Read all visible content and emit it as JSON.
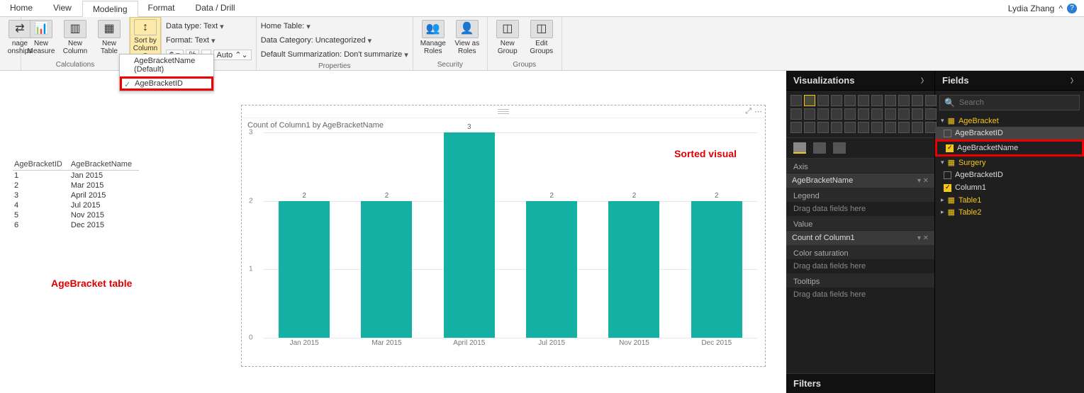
{
  "user": "Lydia Zhang",
  "tabs": [
    "Home",
    "View",
    "Modeling",
    "Format",
    "Data / Drill"
  ],
  "active_tab": "Modeling",
  "ribbon": {
    "relationships_group": "onships",
    "calculations_group": "Calculations",
    "new_measure": "New Measure",
    "new_column": "New Column",
    "new_table": "New Table",
    "sort_by": "Sort by Column",
    "data_type": "Data type: Text",
    "format": "Format: Text",
    "auto": "Auto",
    "properties_group": "Properties",
    "home_table": "Home Table:",
    "data_category": "Data Category: Uncategorized",
    "default_summ": "Default Summarization: Don't summarize",
    "security_group": "Security",
    "manage_roles": "Manage Roles",
    "view_as_roles": "View as Roles",
    "groups_group": "Groups",
    "new_group": "New Group",
    "edit_groups": "Edit Groups",
    "manage_rel": "nage onships"
  },
  "sort_dropdown": {
    "default": "AgeBracketName (Default)",
    "selected": "AgeBracketID"
  },
  "canvas_table": {
    "headers": [
      "AgeBracketID",
      "AgeBracketName"
    ],
    "rows": [
      [
        "1",
        "Jan 2015"
      ],
      [
        "2",
        "Mar 2015"
      ],
      [
        "3",
        "April 2015"
      ],
      [
        "4",
        "Jul 2015"
      ],
      [
        "5",
        "Nov 2015"
      ],
      [
        "6",
        "Dec 2015"
      ]
    ],
    "label": "AgeBracket table"
  },
  "chart_data": {
    "type": "bar",
    "title": "Count of Column1 by AgeBracketName",
    "categories": [
      "Jan 2015",
      "Mar 2015",
      "April 2015",
      "Jul 2015",
      "Nov 2015",
      "Dec 2015"
    ],
    "values": [
      2,
      2,
      3,
      2,
      2,
      2
    ],
    "ylim": [
      0,
      3
    ],
    "yticks": [
      0,
      1,
      2,
      3
    ],
    "annotation": "Sorted visual"
  },
  "viz_panel": {
    "title": "Visualizations",
    "axis_label": "Axis",
    "axis_value": "AgeBracketName",
    "legend_label": "Legend",
    "legend_placeholder": "Drag data fields here",
    "value_label": "Value",
    "value_value": "Count of Column1",
    "colorsat_label": "Color saturation",
    "colorsat_placeholder": "Drag data fields here",
    "tooltips_label": "Tooltips",
    "tooltips_placeholder": "Drag data fields here",
    "filters_label": "Filters"
  },
  "fields_panel": {
    "title": "Fields",
    "search_placeholder": "Search",
    "tables": [
      {
        "name": "AgeBracket",
        "expanded": true,
        "fields": [
          {
            "name": "AgeBracketID",
            "checked": false
          },
          {
            "name": "AgeBracketName",
            "checked": true,
            "highlight": true
          }
        ]
      },
      {
        "name": "Surgery",
        "expanded": true,
        "fields": [
          {
            "name": "AgeBracketID",
            "checked": false
          },
          {
            "name": "Column1",
            "checked": true
          }
        ]
      },
      {
        "name": "Table1",
        "expanded": false
      },
      {
        "name": "Table2",
        "expanded": false
      }
    ]
  }
}
